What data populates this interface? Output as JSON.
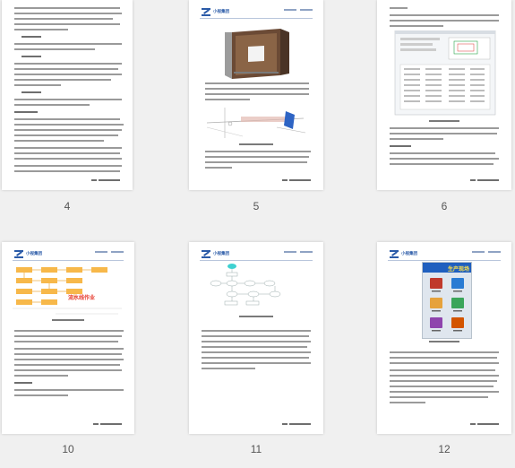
{
  "pages": [
    {
      "number": "4"
    },
    {
      "number": "5"
    },
    {
      "number": "6"
    },
    {
      "number": "10"
    },
    {
      "number": "11"
    },
    {
      "number": "12"
    }
  ],
  "logo_text": "小视集团",
  "diagram_label_10": "流水线作业",
  "app_header_12": "生产现场",
  "colors": {
    "brand": "#2b5ba8",
    "text_line": "#9a9a9a",
    "flow_box": "#f7b84a",
    "flow_red": "#e63b2e",
    "page_bg": "#ffffff",
    "canvas_bg": "#f0f0f0"
  }
}
